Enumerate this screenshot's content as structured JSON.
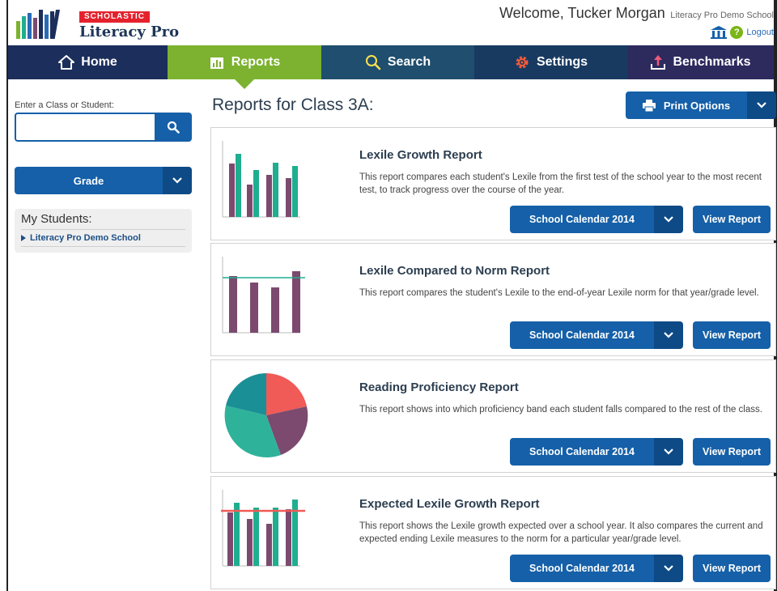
{
  "header": {
    "brand_badge": "SCHOLASTIC",
    "brand_name": "Literacy Pro",
    "welcome": "Welcome, Tucker Morgan",
    "school": "Literacy Pro Demo School",
    "help_label": "?",
    "logout": "Logout"
  },
  "nav": {
    "home": "Home",
    "reports": "Reports",
    "search": "Search",
    "settings": "Settings",
    "benchmarks": "Benchmarks",
    "active": "Reports"
  },
  "sidebar": {
    "search_label": "Enter a Class or Student:",
    "search_value": "",
    "grade_label": "Grade",
    "my_students_title": "My Students:",
    "students": [
      "Literacy Pro Demo School"
    ]
  },
  "main": {
    "page_title": "Reports for Class 3A:",
    "print_options": "Print Options",
    "reports": [
      {
        "title": "Lexile Growth Report",
        "description": "This report compares each student's Lexile from the first test of the school year to the most recent test, to track progress over the course of the year.",
        "calendar": "School Calendar 2014",
        "view": "View Report"
      },
      {
        "title": "Lexile Compared to Norm Report",
        "description": "This report compares the student's Lexile to the end-of-year Lexile norm for that year/grade level.",
        "calendar": "School Calendar 2014",
        "view": "View Report"
      },
      {
        "title": "Reading Proficiency Report",
        "description": "This report shows into which proficiency band each student falls compared to the rest of the class.",
        "calendar": "School Calendar 2014",
        "view": "View Report"
      },
      {
        "title": "Expected Lexile Growth Report",
        "description": "This report shows the Lexile growth expected over a school year. It also compares the current and expected ending Lexile measures to the norm for a particular year/grade level.",
        "calendar": "School Calendar 2014",
        "view": "View Report"
      }
    ]
  },
  "colors": {
    "primary_blue": "#1560a8",
    "dark_blue": "#0d4a86",
    "nav_home": "#1c2e5b",
    "nav_reports": "#7cb22f",
    "nav_search": "#1f4e6e",
    "nav_settings": "#183a61",
    "nav_benchmarks": "#2d2a5e",
    "chart_purple": "#7b4a6e",
    "chart_teal": "#1fae8f",
    "chart_red": "#f05a57",
    "chart_pie_dark_teal": "#1a8f96"
  },
  "icons": {
    "home": "home-icon",
    "reports": "bar-chart-icon",
    "search": "magnifier-icon",
    "settings": "gear-icon",
    "benchmarks": "upload-icon",
    "print": "printer-icon",
    "caret": "chevron-down-icon",
    "help": "help-icon",
    "school": "building-icon"
  }
}
